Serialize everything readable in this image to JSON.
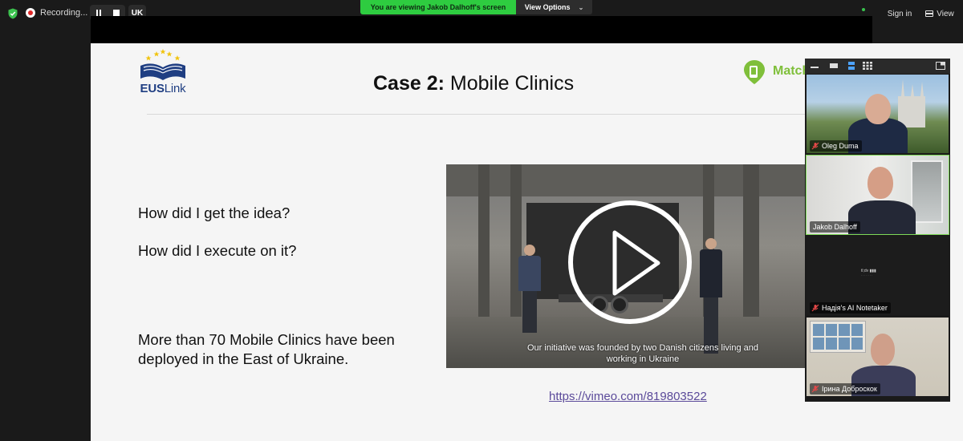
{
  "topbar": {
    "recording_label": "Recording...",
    "language": "UK",
    "viewing_banner": "You are viewing Jakob Dalhoff's screen",
    "view_options_label": "View Options",
    "sign_in_label": "Sign in",
    "view_label": "View"
  },
  "slide": {
    "logo_left_bold": "EUS",
    "logo_left_rest": "Link",
    "title_bold": "Case 2:",
    "title_rest": " Mobile Clinics",
    "logo_right_text": "Match",
    "question_1": "How did I get the idea?",
    "question_2": "How did I execute on it?",
    "statement": "More than 70 Mobile Clinics have been deployed in the East of Ukraine.",
    "video_subtitle": "Our initiative was founded by two Danish citizens living and working in Ukraine",
    "video_link": "https://vimeo.com/819803522"
  },
  "gallery": {
    "participants": [
      {
        "name": "Oleg Duma",
        "muted": true
      },
      {
        "name": "Jakob Dalhoff",
        "muted": false,
        "active_speaker": true
      },
      {
        "name": "Надія's AI Notetaker",
        "muted": true
      },
      {
        "name": "Ірина Доброскок",
        "muted": true
      }
    ]
  },
  "colors": {
    "banner_green": "#2ecc40",
    "active_outline": "#7ed957",
    "link_purple": "#5b4a9a",
    "euslink_blue": "#1f3e82",
    "match_green": "#7fbf3a"
  }
}
